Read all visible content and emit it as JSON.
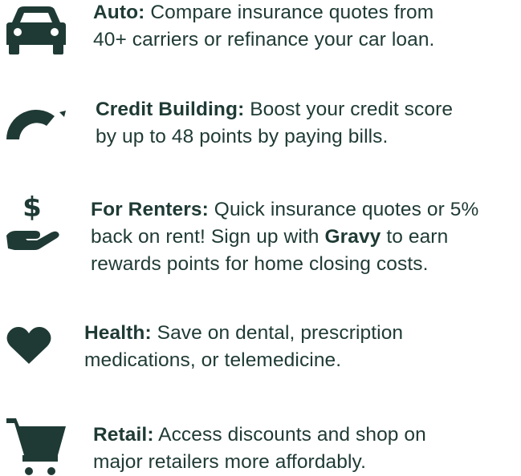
{
  "colors": {
    "text": "#1f3a34",
    "icon": "#1f3a34",
    "background": "#ffffff"
  },
  "items": [
    {
      "icon": "car-icon",
      "title": "Auto:",
      "line1": " Compare insurance quotes from",
      "line2": "40+ carriers or refinance your car loan."
    },
    {
      "icon": "gauge-icon",
      "title": "Credit Building:",
      "line1": " Boost your credit score",
      "line2": "by up to 48 points by paying bills."
    },
    {
      "icon": "hand-dollar-icon",
      "title": "For Renters:",
      "line1": " Quick insurance quotes or 5%",
      "line2_prefix": "back on rent! Sign up with ",
      "line2_bold": "Gravy",
      "line2_suffix": " to earn",
      "line3": "rewards points for home closing costs."
    },
    {
      "icon": "heart-icon",
      "title": "Health:",
      "line1": " Save on dental, prescription",
      "line2": "medications, or telemedicine."
    },
    {
      "icon": "shopping-cart-icon",
      "title": "Retail:",
      "line1": " Access discounts and shop on",
      "line2": "major retailers more affordably."
    }
  ]
}
